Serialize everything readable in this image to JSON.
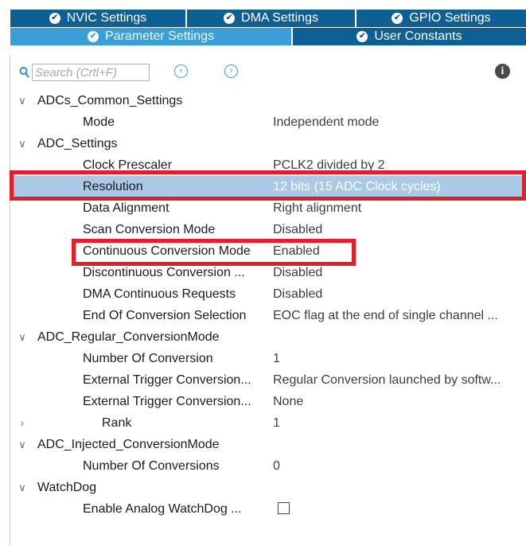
{
  "tabs": {
    "row1": [
      {
        "label": "NVIC Settings",
        "icon": "check-circle-icon"
      },
      {
        "label": "DMA Settings",
        "icon": "check-circle-icon"
      },
      {
        "label": "GPIO Settings",
        "icon": "check-circle-icon"
      }
    ],
    "row2": [
      {
        "label": "Parameter Settings",
        "icon": "check-circle-icon",
        "active": true
      },
      {
        "label": "User Constants",
        "icon": "check-circle-icon"
      }
    ]
  },
  "search": {
    "placeholder": "Search (Crtl+F)",
    "value": "",
    "prev_icon": "arrow-left-circle-icon",
    "next_icon": "arrow-right-circle-icon",
    "info_icon": "info-icon"
  },
  "tree": [
    {
      "type": "group",
      "label": "ADCs_Common_Settings",
      "expanded": true
    },
    {
      "type": "param",
      "label": "Mode",
      "value": "Independent mode"
    },
    {
      "type": "group",
      "label": "ADC_Settings",
      "expanded": true
    },
    {
      "type": "param",
      "label": "Clock Prescaler",
      "value": "PCLK2 divided by 2"
    },
    {
      "type": "param",
      "label": "Resolution",
      "value": "12 bits (15 ADC Clock cycles)",
      "selected": true
    },
    {
      "type": "param",
      "label": "Data Alignment",
      "value": "Right alignment"
    },
    {
      "type": "param",
      "label": "Scan Conversion Mode",
      "value": "Disabled"
    },
    {
      "type": "param",
      "label": "Continuous Conversion Mode",
      "value": "Enabled"
    },
    {
      "type": "param",
      "label": "Discontinuous Conversion ...",
      "value": "Disabled"
    },
    {
      "type": "param",
      "label": "DMA Continuous Requests",
      "value": "Disabled"
    },
    {
      "type": "param",
      "label": "End Of Conversion Selection",
      "value": "EOC flag at the end of single channel ..."
    },
    {
      "type": "group",
      "label": "ADC_Regular_ConversionMode",
      "expanded": true
    },
    {
      "type": "param",
      "label": "Number Of Conversion",
      "value": "1"
    },
    {
      "type": "param",
      "label": "External Trigger Conversion...",
      "value": "Regular Conversion launched by softw..."
    },
    {
      "type": "param",
      "label": "External Trigger Conversion...",
      "value": "None"
    },
    {
      "type": "rank",
      "label": "Rank",
      "value": "1",
      "expanded": false
    },
    {
      "type": "group",
      "label": "ADC_Injected_ConversionMode",
      "expanded": true
    },
    {
      "type": "param",
      "label": "Number Of Conversions",
      "value": "0"
    },
    {
      "type": "group",
      "label": "WatchDog",
      "expanded": true
    },
    {
      "type": "param",
      "label": "Enable Analog WatchDog ...",
      "value": "",
      "checkbox": true,
      "checked": false
    }
  ],
  "glyphs": {
    "check": "✔",
    "expanded": "∨",
    "collapsed": "›",
    "prev": "‹",
    "next": "›",
    "info": "i"
  },
  "colors": {
    "tab_bg": "#0e5f93",
    "tab_active_bg": "#3a9fd6",
    "selected_row_bg": "#a9c9e6",
    "highlight_box": "#e01f26"
  }
}
